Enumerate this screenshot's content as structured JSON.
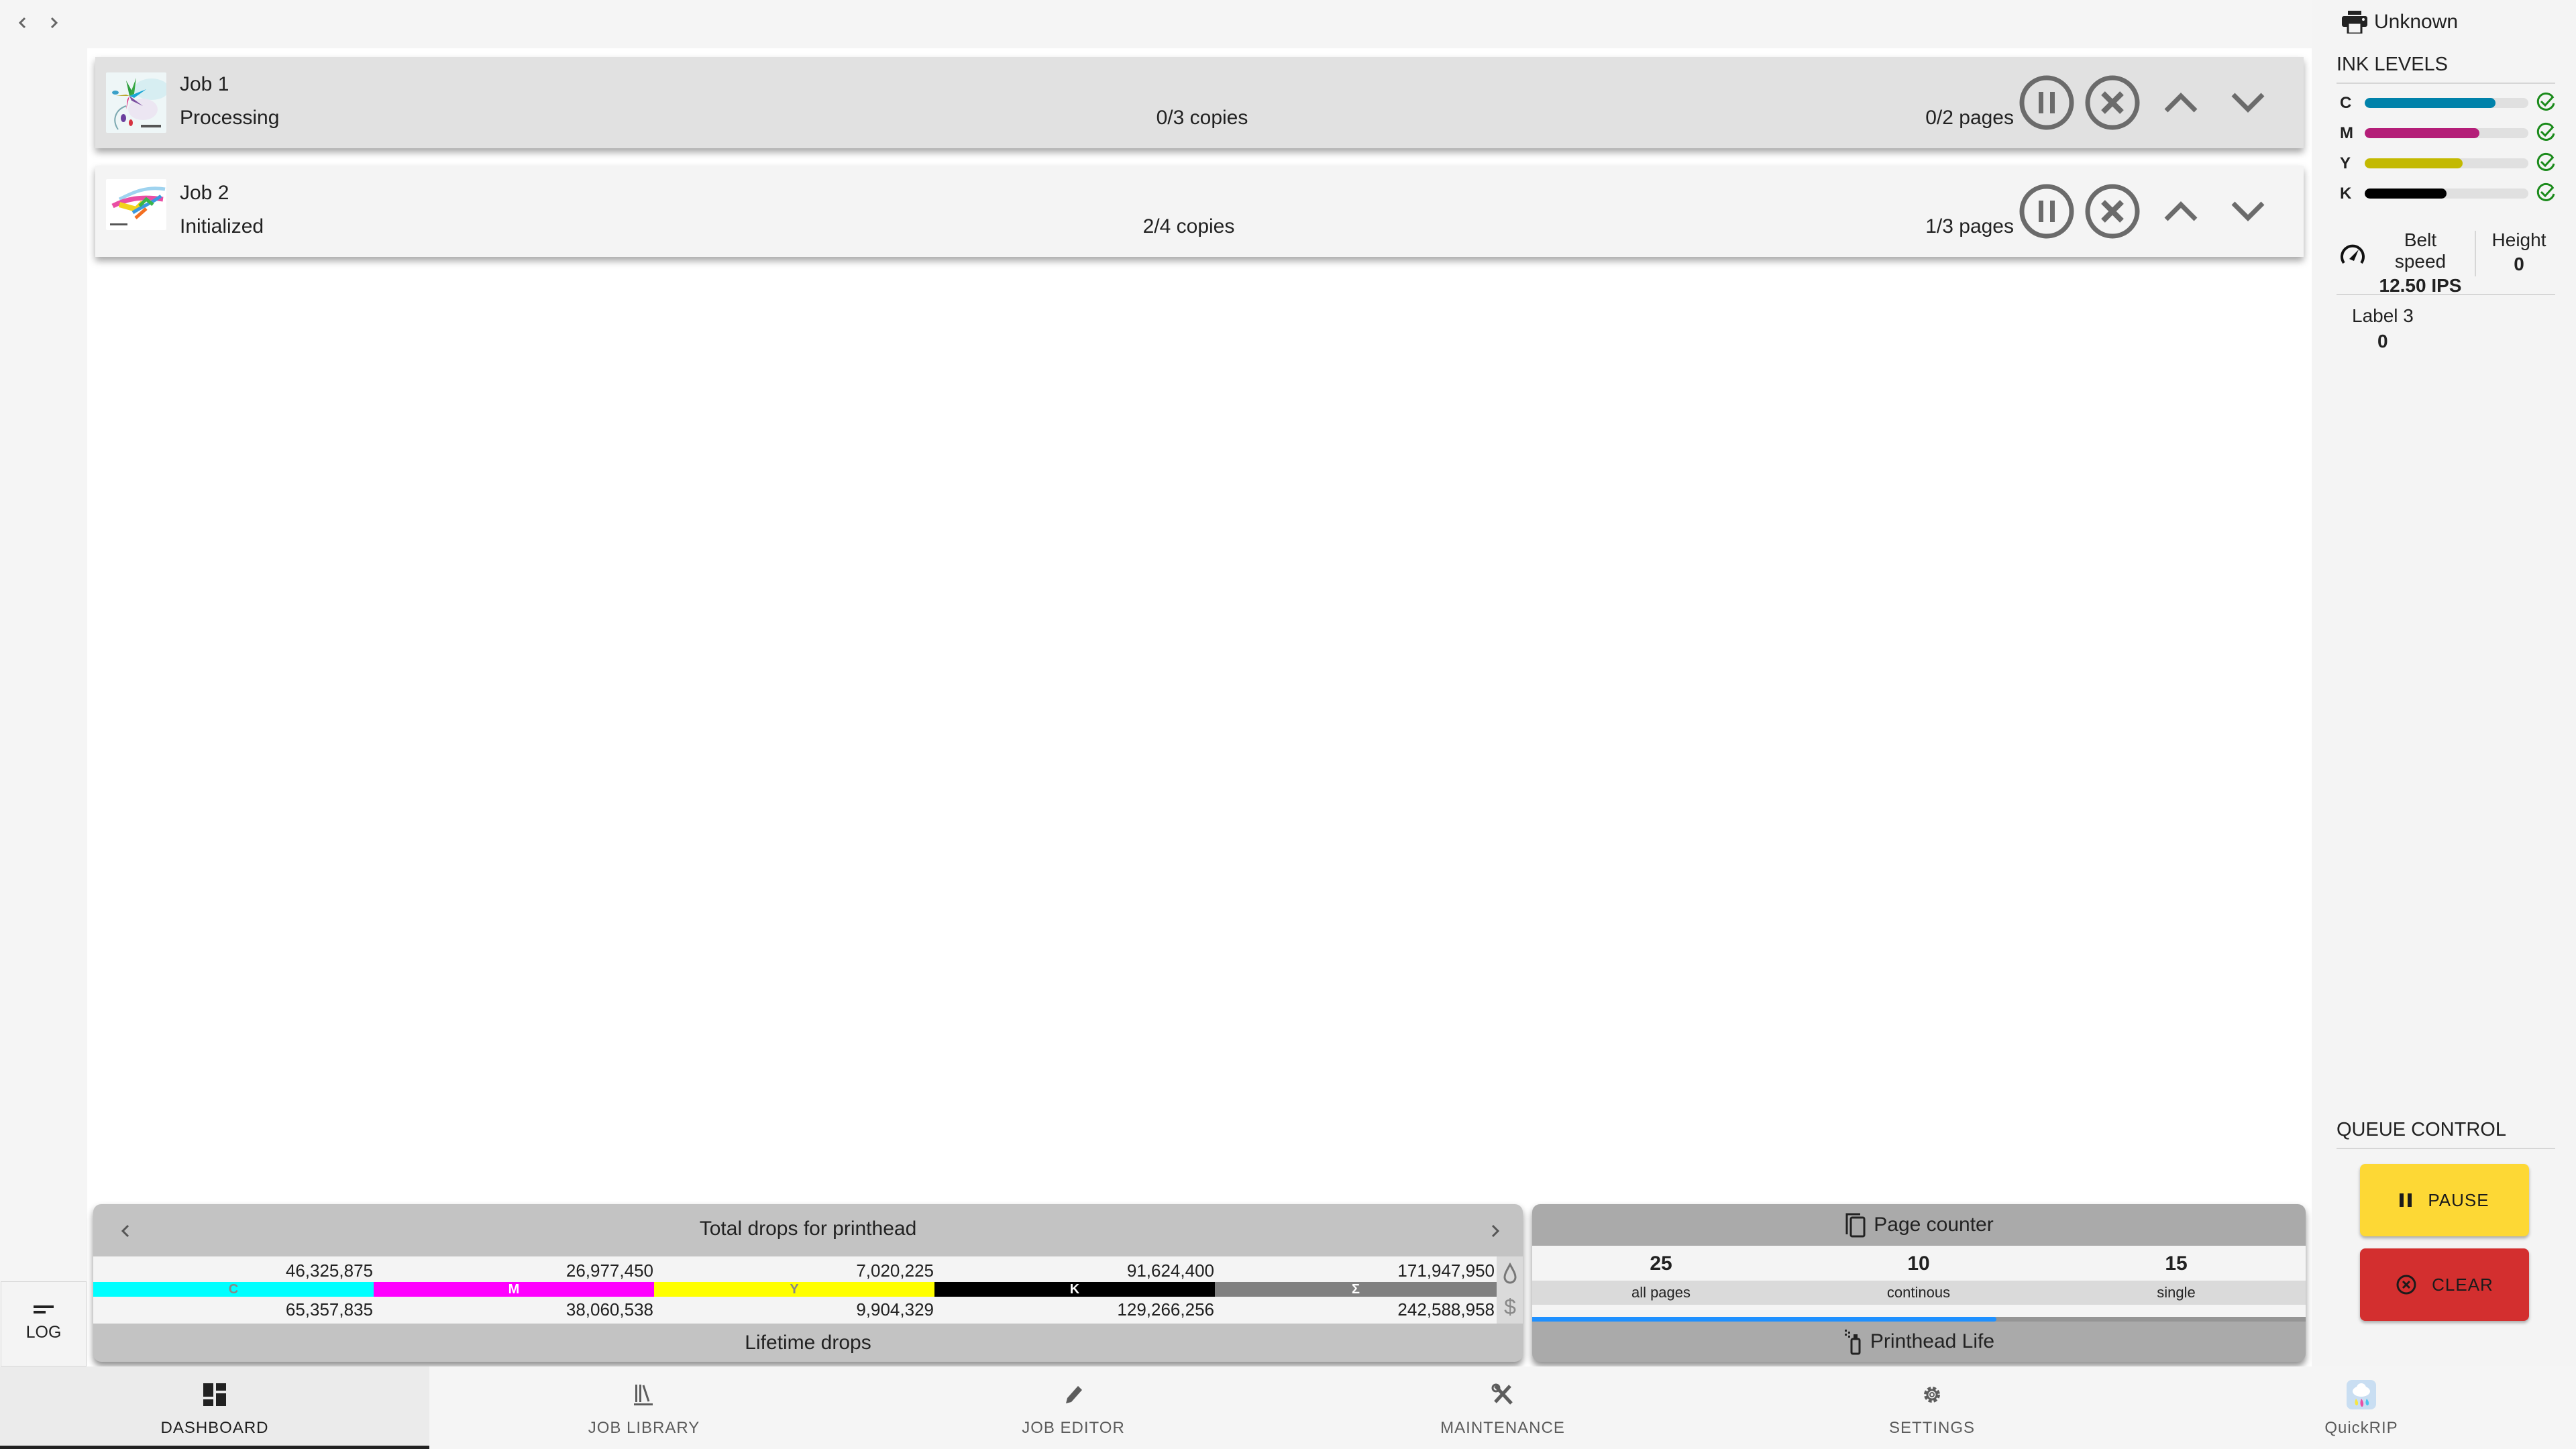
{
  "history_nav": {
    "back_icon": "chevron-left-icon",
    "forward_icon": "chevron-right-icon"
  },
  "jobs": [
    {
      "name": "Job 1",
      "status": "Processing",
      "copies": "0/3 copies",
      "pages": "0/2 pages",
      "active": true,
      "thumbnail": "flower-artwork-thumbnail"
    },
    {
      "name": "Job 2",
      "status": "Initialized",
      "copies": "2/4 copies",
      "pages": "1/3 pages",
      "active": false,
      "thumbnail": "paint-splash-artwork-thumbnail"
    }
  ],
  "drops": {
    "title": "Total drops for printhead",
    "footer": "Lifetime drops",
    "channels": [
      {
        "label": "C",
        "color": "#00ffff",
        "label_color": "#888888",
        "current": "46,325,875",
        "lifetime": "65,357,835"
      },
      {
        "label": "M",
        "color": "#ff00ff",
        "label_color": "#ffffff",
        "current": "26,977,450",
        "lifetime": "38,060,538"
      },
      {
        "label": "Y",
        "color": "#ffff00",
        "label_color": "#888888",
        "current": "7,020,225",
        "lifetime": "9,904,329"
      },
      {
        "label": "K",
        "color": "#000000",
        "label_color": "#ffffff",
        "current": "91,624,400",
        "lifetime": "129,266,256"
      },
      {
        "label": "Σ",
        "color": "#808080",
        "label_color": "#ffffff",
        "current": "171,947,950",
        "lifetime": "242,588,958"
      }
    ]
  },
  "page_counter": {
    "title": "Page counter",
    "items": [
      {
        "value": "25",
        "label": "all pages"
      },
      {
        "value": "10",
        "label": "continous"
      },
      {
        "value": "15",
        "label": "single"
      }
    ],
    "printhead_life_label": "Printhead Life",
    "printhead_life_fraction": 0.6,
    "accent": "#1e90ff"
  },
  "log": {
    "label": "LOG"
  },
  "sidebar": {
    "printer_status": "Unknown",
    "ink_heading": "INK LEVELS",
    "inks": [
      {
        "label": "C",
        "level": 0.8,
        "color": "#0082aa"
      },
      {
        "label": "M",
        "level": 0.7,
        "color": "#b41e78"
      },
      {
        "label": "Y",
        "level": 0.6,
        "color": "#c3b900"
      },
      {
        "label": "K",
        "level": 0.5,
        "color": "#000000"
      }
    ],
    "ok_color": "#1a8a1a",
    "belt_speed_label": "Belt speed",
    "belt_speed_value": "12.50 IPS",
    "height_label": "Height",
    "height_value": "0",
    "label3_label": "Label 3",
    "label3_value": "0",
    "queue_heading": "QUEUE CONTROL",
    "pause_label": "PAUSE",
    "clear_label": "CLEAR",
    "pause_color": "#fdd835",
    "clear_color": "#d32f2f"
  },
  "bottom_nav": [
    {
      "label": "DASHBOARD",
      "icon": "dashboard-icon",
      "active": true
    },
    {
      "label": "JOB LIBRARY",
      "icon": "library-icon",
      "active": false
    },
    {
      "label": "JOB EDITOR",
      "icon": "pencil-icon",
      "active": false
    },
    {
      "label": "MAINTENANCE",
      "icon": "tools-icon",
      "active": false
    },
    {
      "label": "SETTINGS",
      "icon": "gear-icon",
      "active": false
    },
    {
      "label": "QuickRIP",
      "icon": "quickrip-app-icon",
      "active": false
    }
  ]
}
